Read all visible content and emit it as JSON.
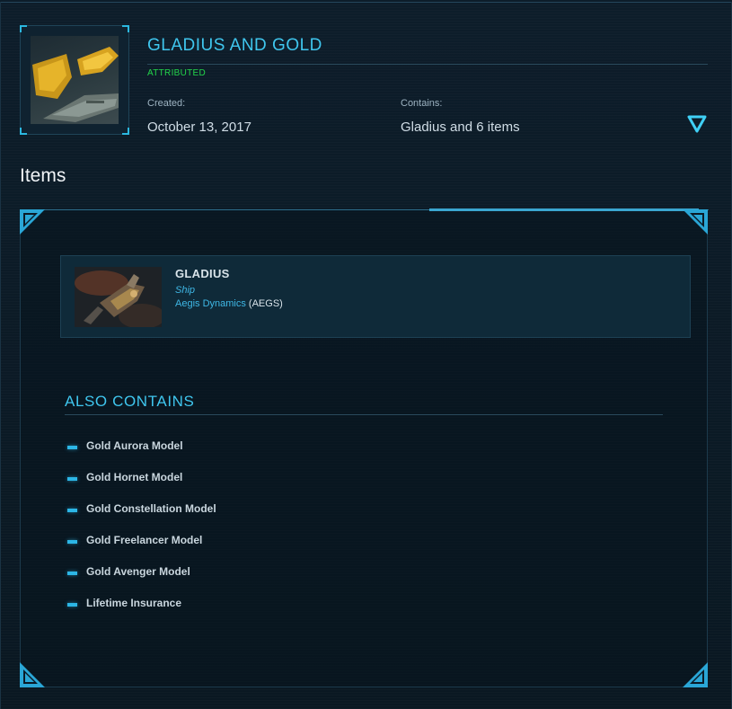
{
  "pledge": {
    "title": "GLADIUS AND GOLD",
    "status": "ATTRIBUTED",
    "created_label": "Created:",
    "created_value": "October 13, 2017",
    "contains_label": "Contains:",
    "contains_value": "Gladius and 6 items",
    "toggle_icon": "chevron-down-triangle-icon"
  },
  "items_section": {
    "heading": "Items",
    "ship": {
      "name": "GLADIUS",
      "type": "Ship",
      "manufacturer": "Aegis Dynamics",
      "manufacturer_code": "(AEGS)"
    },
    "also_contains": {
      "heading": "ALSO CONTAINS",
      "items": [
        "Gold Aurora Model",
        "Gold Hornet Model",
        "Gold Constellation Model",
        "Gold Freelancer Model",
        "Gold Avenger Model",
        "Lifetime Insurance"
      ]
    }
  },
  "colors": {
    "accent": "#3fc6ee",
    "attributed": "#23d44a",
    "background": "#0b1a26"
  }
}
